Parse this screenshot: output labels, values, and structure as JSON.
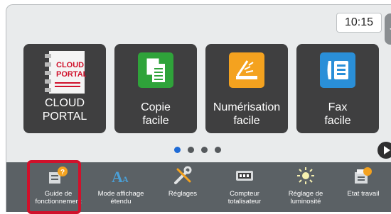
{
  "status": {
    "time": "10:15"
  },
  "tiles": [
    {
      "label": "CLOUD PORTAL",
      "icon": "cloud-portal-icon",
      "logo_text_line1": "CLOUD",
      "logo_text_line2": "PORTAL"
    },
    {
      "label_line1": "Copie",
      "label_line2": "facile",
      "icon": "copy-icon"
    },
    {
      "label_line1": "Numérisation",
      "label_line2": "facile",
      "icon": "scan-icon"
    },
    {
      "label_line1": "Fax",
      "label_line2": "facile",
      "icon": "fax-icon"
    }
  ],
  "pager": {
    "count": 4,
    "active_index": 0
  },
  "bottom_bar": [
    {
      "label_line1": "Guide de",
      "label_line2": "fonctionnement",
      "icon": "help-guide-icon"
    },
    {
      "label_line1": "Mode affichage",
      "label_line2": "étendu",
      "icon": "enlarged-display-icon"
    },
    {
      "label_line1": "Réglages",
      "label_line2": "",
      "icon": "settings-tools-icon"
    },
    {
      "label_line1": "Compteur",
      "label_line2": "totalisateur",
      "icon": "counter-icon"
    },
    {
      "label_line1": "Réglage de",
      "label_line2": "luminosité",
      "icon": "brightness-icon"
    },
    {
      "label_line1": "Etat travail",
      "label_line2": "",
      "icon": "job-status-icon"
    }
  ],
  "colors": {
    "highlight": "#d0112b",
    "accent_dot": "#1f6bd6",
    "bar": "#5b6165",
    "tile": "#3f3f40"
  }
}
